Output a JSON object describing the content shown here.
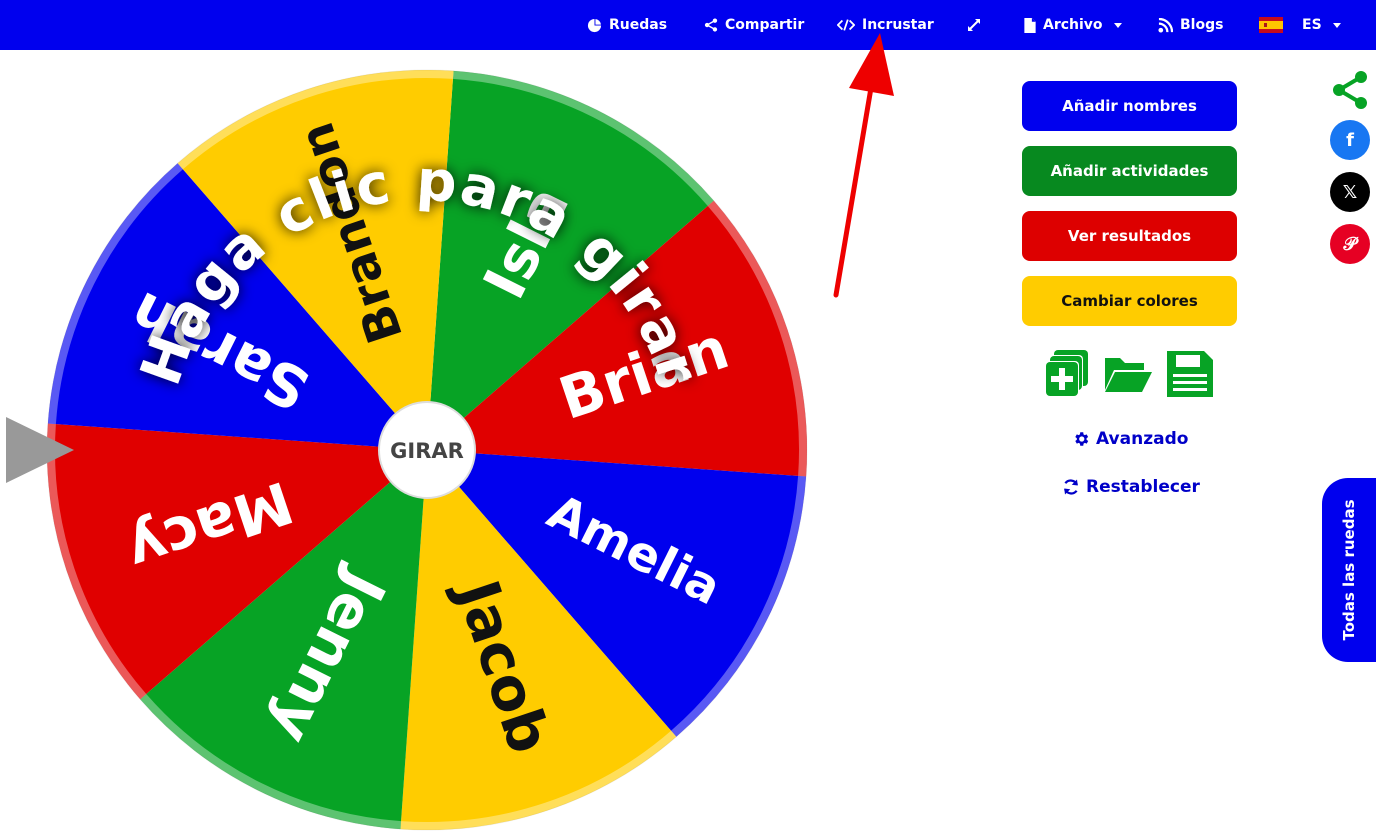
{
  "nav": {
    "wheels": "Ruedas",
    "share": "Compartir",
    "embed": "Incrustar",
    "file": "Archivo",
    "blogs": "Blogs",
    "language": "ES"
  },
  "wheel": {
    "center_label": "GIRAR",
    "overlay_text": "Haga clic para girar",
    "segments": [
      {
        "name": "Isla",
        "color": "#07a325"
      },
      {
        "name": "Brian",
        "color": "#e00000"
      },
      {
        "name": "Amelia",
        "color": "#0000ee"
      },
      {
        "name": "Jacob",
        "color": "#ffcc00"
      },
      {
        "name": "Jenny",
        "color": "#07a325"
      },
      {
        "name": "Macy",
        "color": "#e00000"
      },
      {
        "name": "Sarah",
        "color": "#0000ee"
      },
      {
        "name": "Brandon",
        "color": "#ffcc00"
      }
    ]
  },
  "panel": {
    "add_names": "Añadir nombres",
    "add_activities": "Añadir actividades",
    "view_results": "Ver resultados",
    "change_colors": "Cambiar colores",
    "advanced": "Avanzado",
    "reset": "Restablecer"
  },
  "side_tab": "Todas las ruedas",
  "colors": {
    "brand_blue": "#0000ee",
    "green": "#07a325",
    "red": "#e00000",
    "yellow": "#ffcc00",
    "arrow_red": "#ee0000"
  },
  "icons": [
    "pie-chart-icon",
    "share-icon",
    "code-icon",
    "expand-icon",
    "file-icon",
    "rss-icon",
    "spain-flag-icon",
    "new-file-icon",
    "folder-open-icon",
    "save-icon",
    "gear-icon",
    "refresh-icon",
    "facebook-icon",
    "x-icon",
    "pinterest-icon"
  ]
}
